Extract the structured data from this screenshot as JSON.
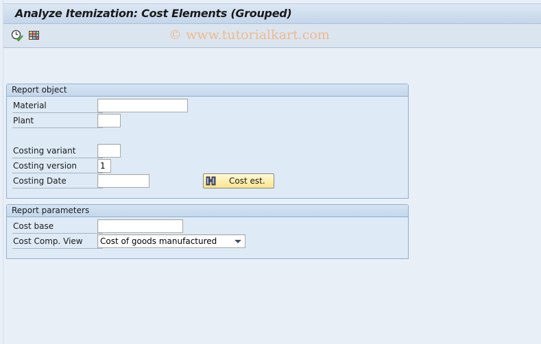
{
  "window": {
    "title": "Analyze Itemization: Cost Elements (Grouped)"
  },
  "toolbar": {
    "items": [
      {
        "icon": "execute-clock-check-icon",
        "tooltip": ""
      },
      {
        "icon": "layout-grid-icon",
        "tooltip": ""
      }
    ]
  },
  "watermark": "© www.tutorialkart.com",
  "report_object": {
    "title": "Report object",
    "fields": {
      "material": {
        "label": "Material",
        "value": ""
      },
      "plant": {
        "label": "Plant",
        "value": ""
      },
      "costing_variant": {
        "label": "Costing variant",
        "value": ""
      },
      "costing_version": {
        "label": "Costing version",
        "value": "1"
      },
      "costing_date": {
        "label": "Costing Date",
        "value": ""
      }
    },
    "cost_est_button": {
      "label": "Cost est.",
      "icon": "binoculars-icon"
    }
  },
  "report_parameters": {
    "title": "Report parameters",
    "fields": {
      "cost_base": {
        "label": "Cost base",
        "value": ""
      },
      "cost_comp_view": {
        "label": "Cost Comp. View",
        "value": "Cost of goods manufactured"
      }
    }
  },
  "colors": {
    "background": "#e8eff7",
    "title_bar": "#c4d6ea",
    "group_border": "#90aecd",
    "button_yellow": "#fbe58e",
    "watermark": "#f0b98a"
  }
}
